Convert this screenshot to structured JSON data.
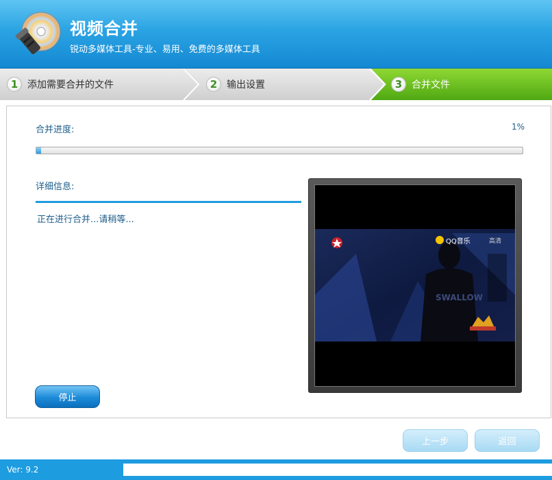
{
  "header": {
    "title": "视频合并",
    "subtitle": "锐动多媒体工具-专业、易用、免费的多媒体工具"
  },
  "steps": [
    {
      "number": "1",
      "label": "添加需要合并的文件",
      "active": false
    },
    {
      "number": "2",
      "label": "输出设置",
      "active": false
    },
    {
      "number": "3",
      "label": "合并文件",
      "active": true
    }
  ],
  "progress": {
    "label": "合并进度:",
    "percent_text": "1%",
    "value_percent": 1
  },
  "details": {
    "label": "详细信息:",
    "status": "正在进行合并...请稍等..."
  },
  "preview": {
    "overlay_channel_text": "QQ音乐",
    "overlay_hd": "高清",
    "overlay_shirt": "SWALLOW"
  },
  "buttons": {
    "stop": "停止",
    "prev": "上一步",
    "back": "返回"
  },
  "footer": {
    "version": "Ver: 9.2"
  },
  "colors": {
    "header_blue": "#2aa3e3",
    "active_step_green": "#6cc21d",
    "footer_blue": "#1d9ce0"
  }
}
